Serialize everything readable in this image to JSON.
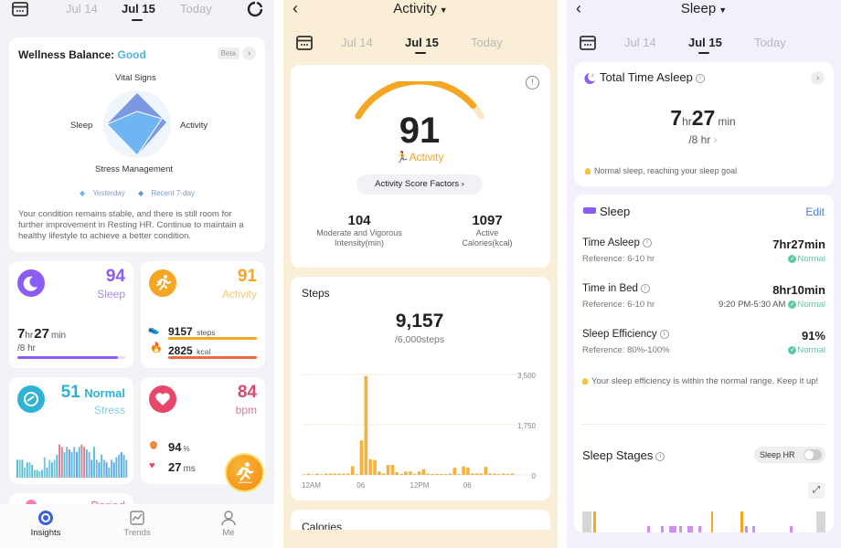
{
  "insights": {
    "dates": [
      "Jul 14",
      "Jul 15",
      "Today"
    ],
    "selected_date": "Jul 15",
    "wellness": {
      "title": "Wellness Balance:",
      "status": "Good",
      "badge": "Beta",
      "radar_axes": [
        "Vital Signs",
        "Activity",
        "Stress Management",
        "Sleep"
      ],
      "legend": [
        "Yesterday",
        "Recent 7-day"
      ],
      "description": "Your condition remains stable, and there is still room for further improvement in Resting HR. Continue to maintain a healthy lifestyle to achieve a better condition."
    },
    "sleep_card": {
      "score": "94",
      "label": "Sleep",
      "hours": "7",
      "hr_unit": "hr",
      "mins": "27",
      "min_unit": "min",
      "goal": "/8 hr",
      "progress": 0.93
    },
    "activity_card": {
      "score": "91",
      "label": "Activity",
      "steps": "9157",
      "steps_unit": "steps",
      "kcal": "2825",
      "kcal_unit": "kcal"
    },
    "stress_card": {
      "value": "51",
      "status": "Normal",
      "label": "Stress"
    },
    "heart_card": {
      "value": "84",
      "unit": "bpm",
      "spo2": "94",
      "spo2_unit": "%",
      "hrv": "27",
      "hrv_unit": "ms"
    },
    "period_card": {
      "label": "Period"
    },
    "nav": [
      {
        "label": "Insights",
        "icon": "insights-icon",
        "active": true
      },
      {
        "label": "Trends",
        "icon": "trends-icon",
        "active": false
      },
      {
        "label": "Me",
        "icon": "person-icon",
        "active": false
      }
    ]
  },
  "activity": {
    "title": "Activity",
    "dates": [
      "Jul 14",
      "Jul 15",
      "Today"
    ],
    "score": "91",
    "score_label": "Activity",
    "score_fraction": 0.91,
    "factors_button": "Activity Score Factors",
    "stats": [
      {
        "value": "104",
        "label1": "Moderate and Vigorous",
        "label2": "Intensity(min)"
      },
      {
        "value": "1097",
        "label1": "Active",
        "label2": "Calories(kcal)"
      }
    ],
    "steps": {
      "title": "Steps",
      "value": "9,157",
      "goal": "/6,000steps"
    },
    "next_section": "Calories"
  },
  "chart_data": {
    "type": "bar",
    "title": "Steps",
    "xlabel": "",
    "ylabel": "",
    "x_tick_labels": [
      "12AM",
      "06",
      "12PM",
      "06"
    ],
    "y_tick_labels": [
      "3,500",
      "1,750",
      "0"
    ],
    "ylim": [
      0,
      3500
    ],
    "grid": true,
    "categories_note": "30-minute intervals",
    "values": [
      20,
      0,
      20,
      0,
      20,
      0,
      0,
      0,
      0,
      0,
      0,
      300,
      30,
      1200,
      3450,
      550,
      520,
      120,
      0,
      350,
      350,
      100,
      30,
      120,
      120,
      30,
      120,
      200,
      0,
      30,
      30,
      30,
      30,
      0,
      250,
      30,
      300,
      250,
      50,
      50,
      50,
      280,
      50,
      0,
      30,
      0,
      30,
      0
    ]
  },
  "sleep": {
    "title": "Sleep",
    "dates": [
      "Jul 14",
      "Jul 15",
      "Today"
    ],
    "total": {
      "title": "Total Time Asleep",
      "hours": "7",
      "hr_unit": "hr",
      "mins": "27",
      "min_unit": "min",
      "goal": "/8 hr",
      "tip": "Normal sleep, reaching your sleep goal"
    },
    "detail": {
      "title": "Sleep",
      "edit": "Edit",
      "rows": [
        {
          "label": "Time Asleep",
          "value": "7hr27min",
          "reference": "Reference: 6-10 hr",
          "time": "",
          "status": "Normal"
        },
        {
          "label": "Time in Bed",
          "value": "8hr10min",
          "reference": "Reference: 6-10 hr",
          "time": "9:20 PM-5:30 AM",
          "status": "Normal"
        },
        {
          "label": "Sleep Efficiency",
          "value": "91%",
          "reference": "Reference: 80%-100%",
          "time": "",
          "status": "Normal"
        }
      ],
      "tip": "Your sleep efficiency is within the normal range. Keep it up!",
      "stages_title": "Sleep Stages",
      "sleep_hr_toggle": "Sleep HR",
      "sleep_hr_on": false
    }
  },
  "colors": {
    "sleep": "#8b5cf6",
    "activity": "#f5a623",
    "stress": "#2eb3d4",
    "heart": "#e8476a",
    "normal": "#5ecaa0",
    "link": "#4a7bd8"
  }
}
